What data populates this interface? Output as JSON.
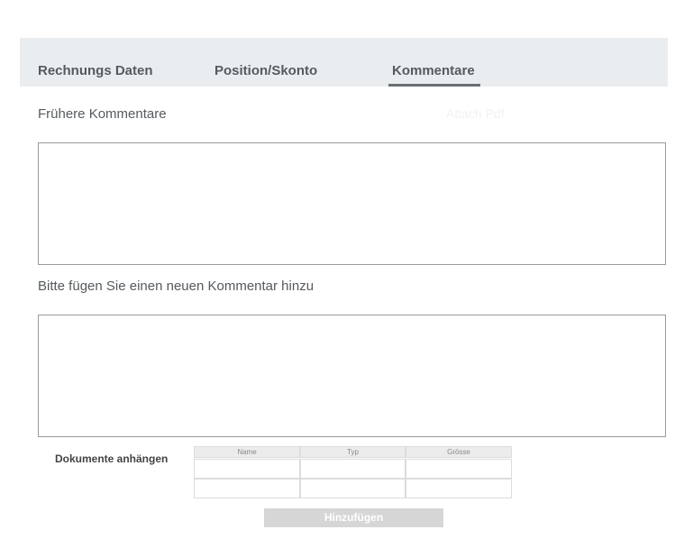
{
  "tabs": [
    {
      "label": "Rechnungs Daten",
      "active": false
    },
    {
      "label": "Position/Skonto",
      "active": false
    },
    {
      "label": "Kommentare",
      "active": true
    }
  ],
  "comments": {
    "previous_label": "Frühere Kommentare",
    "faint_link": "Attach Pdf",
    "previous_value": "",
    "new_label": "Bitte fügen Sie einen neuen Kommentar hinzu",
    "new_value": ""
  },
  "attachments": {
    "label": "Dokumente anhängen",
    "columns": [
      "Name",
      "Typ",
      "Grösse"
    ],
    "rows": [
      [
        "",
        "",
        ""
      ],
      [
        "",
        "",
        ""
      ]
    ]
  },
  "add_button_label": "Hinzufügen",
  "colors": {
    "tabbar_bg": "#eaedf0",
    "active_underline": "#6a6f73",
    "button_bg": "#d6d6d6"
  }
}
